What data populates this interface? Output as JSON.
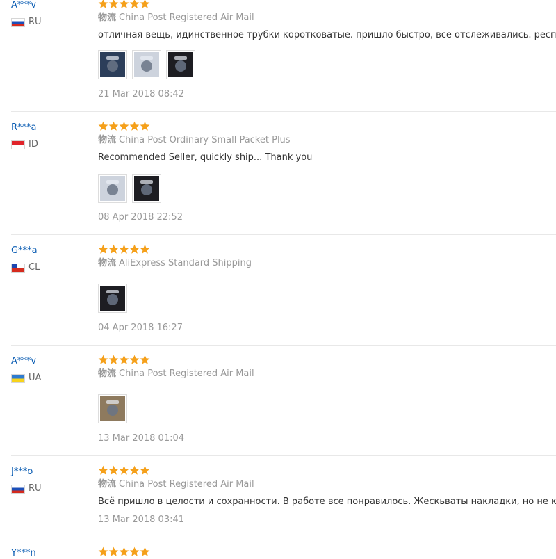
{
  "colors": {
    "username": "#0b5db3",
    "star": "#f5a01a",
    "muted_text": "#999999",
    "body_text": "#333333",
    "separator": "#e8e8e8"
  },
  "reviews": [
    {
      "user": "A***v",
      "country": "RU",
      "rating": 5,
      "shipping_tag": "物流",
      "shipping_method": "China Post Registered Air Mail",
      "text": "отличная вещь, идинственное трубки коротковатые. пришло быстро, все отслеживались. респект прод",
      "photos": [
        "product-photo",
        "product-photo",
        "product-photo"
      ],
      "date": "21 Mar 2018 08:42"
    },
    {
      "user": "R***a",
      "country": "ID",
      "rating": 5,
      "shipping_tag": "物流",
      "shipping_method": "China Post Ordinary Small Packet Plus",
      "text": "Recommended Seller, quickly ship... Thank you",
      "photos": [
        "product-photo",
        "product-photo"
      ],
      "date": "08 Apr 2018 22:52"
    },
    {
      "user": "G***a",
      "country": "CL",
      "rating": 5,
      "shipping_tag": "物流",
      "shipping_method": "AliExpress Standard Shipping",
      "text": "",
      "photos": [
        "product-photo"
      ],
      "date": "04 Apr 2018 16:27"
    },
    {
      "user": "A***v",
      "country": "UA",
      "rating": 5,
      "shipping_tag": "物流",
      "shipping_method": "China Post Registered Air Mail",
      "text": "",
      "photos": [
        "product-photo"
      ],
      "date": "13 Mar 2018 01:04"
    },
    {
      "user": "J***o",
      "country": "RU",
      "rating": 5,
      "shipping_tag": "物流",
      "shipping_method": "China Post Registered Air Mail",
      "text": "Всё пришло в целости и сохранности. В работе все понравилось. Жескьваты накладки, но не критично.",
      "photos": [],
      "date": "13 Mar 2018 03:41"
    },
    {
      "user": "Y***n",
      "country": "",
      "rating": 5,
      "shipping_tag": "",
      "shipping_method": "",
      "text": "",
      "photos": [],
      "date": ""
    }
  ]
}
